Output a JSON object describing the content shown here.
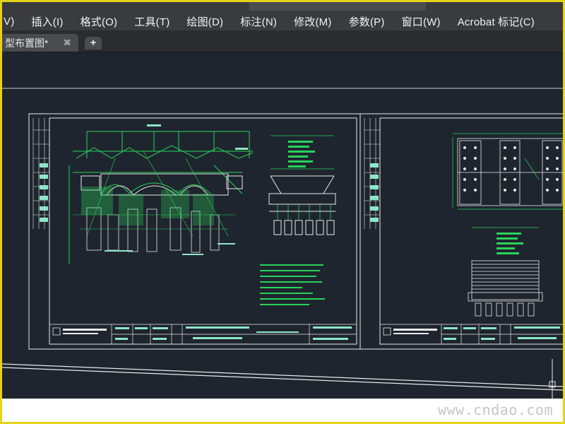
{
  "menubar": {
    "items": [
      {
        "label": "V)"
      },
      {
        "label": "插入(I)"
      },
      {
        "label": "格式(O)"
      },
      {
        "label": "工具(T)"
      },
      {
        "label": "绘图(D)"
      },
      {
        "label": "标注(N)"
      },
      {
        "label": "修改(M)"
      },
      {
        "label": "参数(P)"
      },
      {
        "label": "窗口(W)"
      },
      {
        "label": "Acrobat 标记(C)"
      }
    ]
  },
  "tabs": {
    "active": {
      "label": "型布置图*",
      "close_icon": "close-icon"
    },
    "add_icon": "plus-icon",
    "add_label": "+"
  },
  "watermark": {
    "text": "www.cndao.com"
  },
  "colors": {
    "menubar_bg": "#3a3b3e",
    "canvas_bg": "#1f252e",
    "line_white": "#e8e8e8",
    "line_green": "#27d35a",
    "line_cyan": "#8ee6c8",
    "frame": "#e6d21a"
  }
}
